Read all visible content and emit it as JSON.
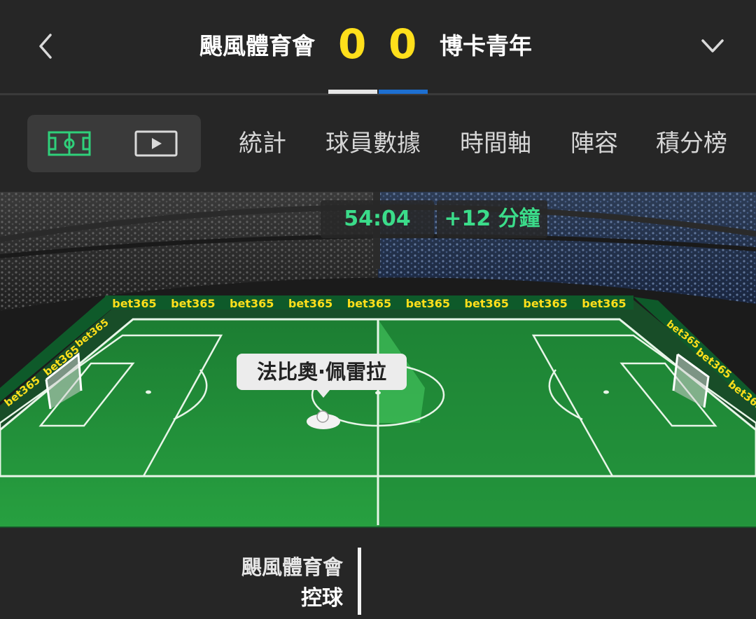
{
  "header": {
    "home_team": "颶風體育會",
    "away_team": "博卡青年",
    "home_score": "0",
    "away_score": "0"
  },
  "tabs": [
    {
      "label": "統計"
    },
    {
      "label": "球員數據"
    },
    {
      "label": "時間軸"
    },
    {
      "label": "陣容"
    },
    {
      "label": "積分榜"
    }
  ],
  "match": {
    "clock": "54:04",
    "added_time": "+12 分鐘",
    "player_tooltip": "法比奧·佩雷拉",
    "sponsor": "bet365",
    "sponsor_color": "#ffdf1b"
  },
  "possession": {
    "team": "颶風體育會",
    "label": "控球"
  },
  "colors": {
    "score": "#ffdf1b",
    "clock": "#3bdc8a",
    "home_bar": "#e6e6e6",
    "away_bar": "#1d6fd1",
    "pitch": "#1f8f3a"
  }
}
